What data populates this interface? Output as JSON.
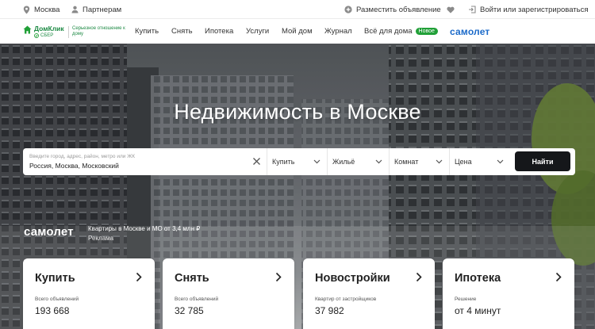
{
  "topbar": {
    "city": "Москва",
    "partners": "Партнерам",
    "post_ad": "Разместить объявление",
    "login": "Войти или зарегистрироваться"
  },
  "logo": {
    "name": "ДомКлик",
    "sub": "СБЕР",
    "tagline": "Серьезное отношение к дому"
  },
  "nav": {
    "items": [
      "Купить",
      "Снять",
      "Ипотека",
      "Услуги",
      "Мой дом",
      "Журнал",
      "Всё для дома"
    ],
    "new_badge": "Новое",
    "partner_brand": "самолет"
  },
  "hero": {
    "title": "Недвижимость в Москве"
  },
  "search": {
    "placeholder": "Введите город, адрес, район, метро или ЖК",
    "value": "Россия, Москва, Московский",
    "deal": "Купить",
    "type": "Жильё",
    "rooms": "Комнат",
    "price": "Цена",
    "submit": "Найти"
  },
  "ad": {
    "brand": "самолет",
    "text": "Квартиры в Москве и МО от 3,4 млн ₽",
    "label": "Реклама"
  },
  "cards": [
    {
      "title": "Купить",
      "sub": "Всего объявлений",
      "value": "193 668"
    },
    {
      "title": "Снять",
      "sub": "Всего объявлений",
      "value": "32 785"
    },
    {
      "title": "Новостройки",
      "sub": "Квартир от застройщиков",
      "value": "37 982"
    },
    {
      "title": "Ипотека",
      "sub": "Решение",
      "value": "от 4 минут"
    }
  ],
  "colors": {
    "brand_green": "#21a038",
    "partner_blue": "#1b6ac9",
    "search_button": "#15171a"
  }
}
